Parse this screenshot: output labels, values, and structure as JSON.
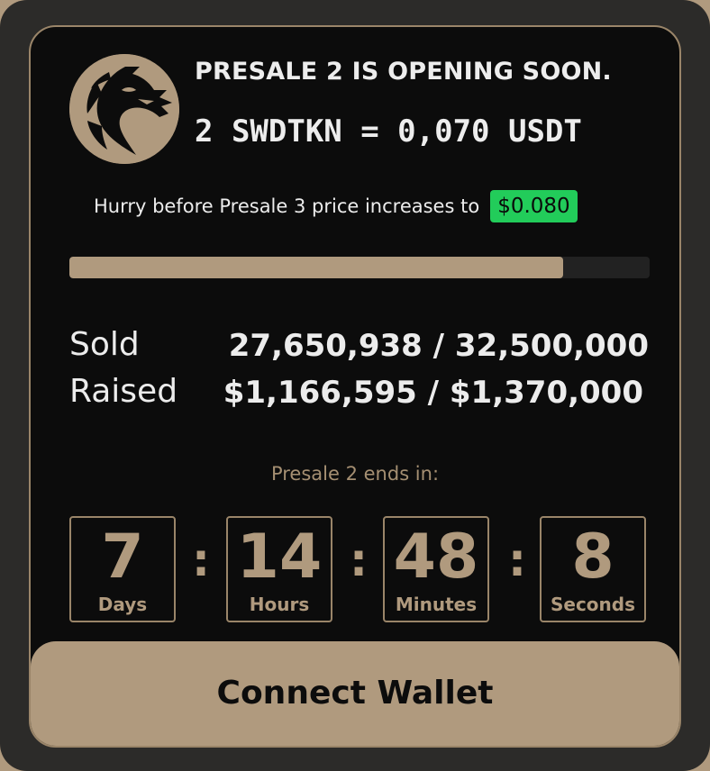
{
  "header": {
    "title": "PRESALE 2 IS OPENING SOON.",
    "rate": "2 SWDTKN = 0,070 USDT",
    "logo_icon": "dragon-logo-icon"
  },
  "hurry": {
    "text": "Hurry before Presale 3 price increases to",
    "price": "$0.080"
  },
  "progress": {
    "fraction": 0.8508
  },
  "stats": {
    "sold_label": "Sold",
    "sold_value": "27,650,938 / 32,500,000",
    "raised_label": "Raised",
    "raised_value": "$1,166,595 / $1,370,000"
  },
  "countdown": {
    "label": "Presale 2 ends in:",
    "separator": ":",
    "days": {
      "value": "7",
      "unit": "Days"
    },
    "hours": {
      "value": "14",
      "unit": "Hours"
    },
    "minutes": {
      "value": "48",
      "unit": "Minutes"
    },
    "seconds": {
      "value": "8",
      "unit": "Seconds"
    }
  },
  "actions": {
    "connect_label": "Connect Wallet"
  },
  "colors": {
    "accent": "#b09a7e",
    "card": "#0c0c0c",
    "badge": "#22cc5a",
    "text": "#ececec"
  }
}
